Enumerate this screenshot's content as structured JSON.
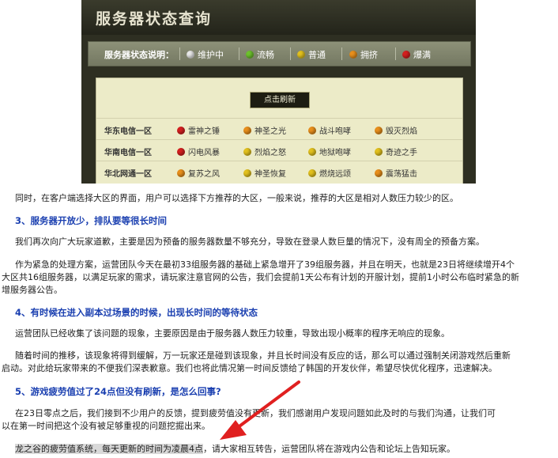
{
  "status_image": {
    "title": "服务器状态查询",
    "legend_label": "服务器状态说明：",
    "legend": [
      {
        "label": "维护中",
        "color": "#e8e8e8"
      },
      {
        "label": "流畅",
        "color": "#6dc22c"
      },
      {
        "label": "普通",
        "color": "#e2c11e"
      },
      {
        "label": "拥挤",
        "color": "#e88f1c"
      },
      {
        "label": "爆满",
        "color": "#d41f1f"
      }
    ],
    "refresh_button": "点击刷新",
    "regions": [
      {
        "name": "华东电信一区",
        "servers": [
          {
            "name": "雷神之锤",
            "color": "#d41f1f"
          },
          {
            "name": "神圣之光",
            "color": "#e88f1c"
          },
          {
            "name": "战斗咆哮",
            "color": "#e88f1c"
          },
          {
            "name": "毁灭烈焰",
            "color": "#e88f1c"
          }
        ]
      },
      {
        "name": "华南电信一区",
        "servers": [
          {
            "name": "闪电风暴",
            "color": "#d41f1f"
          },
          {
            "name": "烈焰之怒",
            "color": "#e2c11e"
          },
          {
            "name": "地狱咆哮",
            "color": "#e2c11e"
          },
          {
            "name": "奇迹之手",
            "color": "#e2c11e"
          }
        ]
      },
      {
        "name": "华北网通一区",
        "servers": [
          {
            "name": "复苏之风",
            "color": "#e88f1c"
          },
          {
            "name": "神圣恢复",
            "color": "#e2c11e"
          },
          {
            "name": "燃烧远颂",
            "color": "#e2c11e"
          },
          {
            "name": "震荡猛击",
            "color": "#e88f1c"
          }
        ]
      }
    ]
  },
  "article": {
    "p1": "同时，在客户端选择大区的界面，用户可以选择下方推荐的大区，一般来说，推荐的大区是相对人数压力较少的区。",
    "h3": "3、服务器开放少，排队要等很长时间",
    "p2": "我们再次向广大玩家道歉，主要是因为预备的服务器数量不够充分，导致在登录人数巨量的情况下，没有周全的预备方案。",
    "p3a": "作为紧急的处理方案，运营团队今天在最初33组服务器的基础上紧急增开了39组服务器，并且在明天，也就是23日将继续增开4个",
    "p3b": "大区共16组服务器，以满足玩家的需求，请玩家注意官网的公告，我们会提前1天公布有计划的开服计划，提前1小时公布临时紧急的新",
    "p3c": "增服务器公告。",
    "h4": "4、有时候在进入副本过场景的时候，出现长时间的等待状态",
    "p4": "运营团队已经收集了该问题的现象，主要原因是由于服务器人数压力较重，导致出现小概率的程序无响应的现象。",
    "p5a": "随着时间的推移，该现象将得到缓解，万一玩家还是碰到该现象，并且长时间没有反应的话，那么可以通过强制关闭游戏然后重新",
    "p5b": "启动。对此给玩家带来的不便我们深表歉意。我们也将此情况第一时间反馈给了韩国的开发伙伴，希望尽快优化程序，迅速解决。",
    "h5": "5、游戏疲劳值过了24点但没有刷新，是怎么回事?",
    "p6a": "在23日零点之后，我们接到不少用户的反馈，提到疲劳值没有更新，我们感谢用户发现问题如此及时的与我们沟通，让我们可",
    "p6b": "以在第一时间把这个没有被足够重视的问题挖掘出来。",
    "p7_highlight": "龙之谷的疲劳值系统，每天更新的时间为凌晨4点",
    "p7_rest": "，请大家相互转告，运营团队将在游戏内公告和论坛上告知玩家。"
  },
  "colors": {
    "heading": "#1a3fb0",
    "arrow": "#e02020",
    "highlight": "#d9d9d9"
  }
}
